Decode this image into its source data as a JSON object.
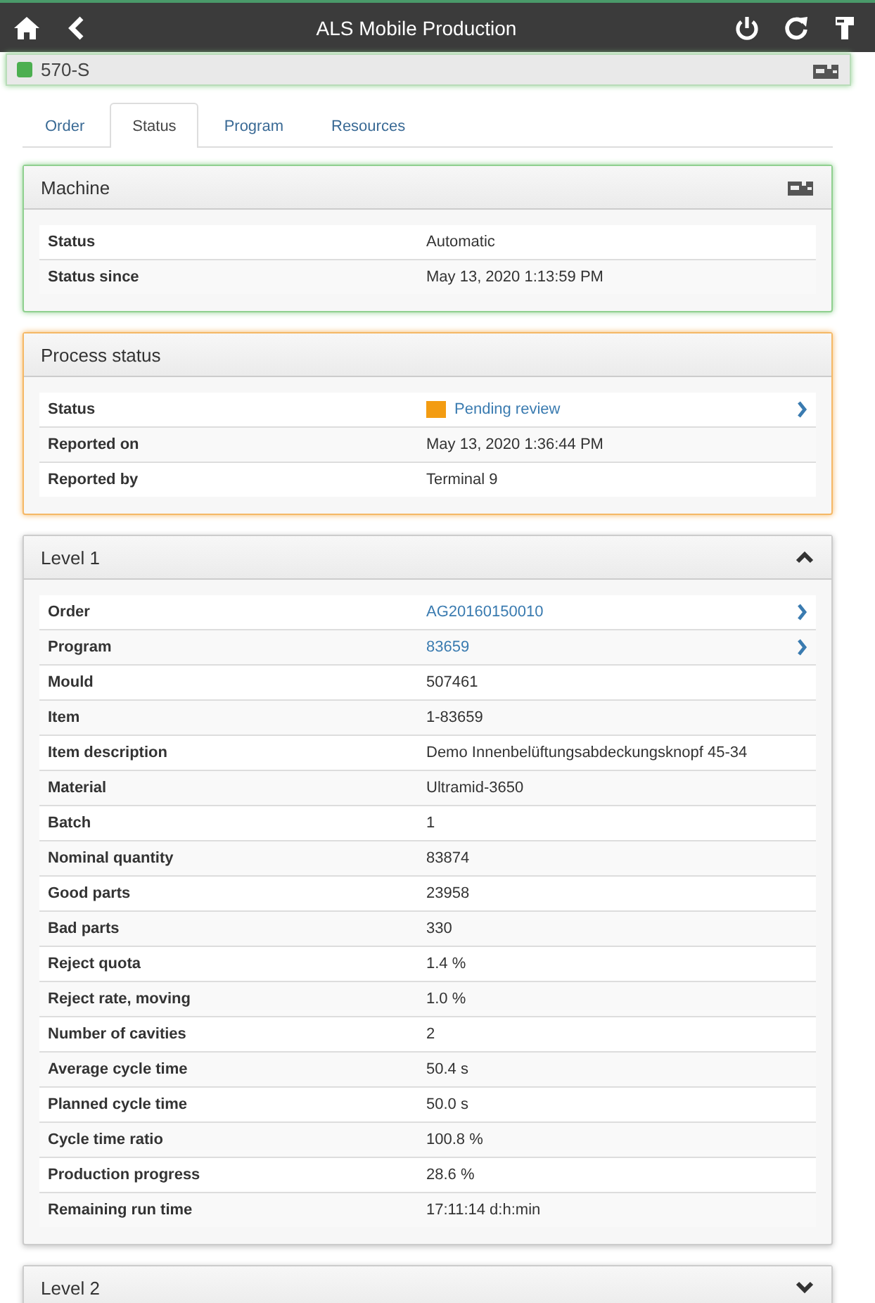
{
  "app_bar": {
    "title": "ALS Mobile Production"
  },
  "machine_bar": {
    "name": "570-S",
    "color": "#4caf50"
  },
  "tabs": [
    {
      "label": "Order",
      "selected": false
    },
    {
      "label": "Status",
      "selected": true
    },
    {
      "label": "Program",
      "selected": false
    },
    {
      "label": "Resources",
      "selected": false
    }
  ],
  "panels": [
    {
      "kind": "machine",
      "title": "Machine",
      "color": "#8fd08f",
      "rows": [
        {
          "label": "Status",
          "value": "Automatic",
          "link": false
        },
        {
          "label": "Status since",
          "value": "May 13, 2020 1:13:59 PM",
          "link": false
        }
      ]
    },
    {
      "kind": "process",
      "title": "Process status",
      "color": "#f5b866",
      "rows": [
        {
          "label": "Status",
          "value": "Pending review",
          "link": true,
          "color": "#f39c12"
        },
        {
          "label": "Reported on",
          "value": "May 13, 2020 1:36:44 PM",
          "link": false
        },
        {
          "label": "Reported by",
          "value": "Terminal 9",
          "link": false
        }
      ]
    },
    {
      "kind": "level",
      "title": "Level 1",
      "expanded": true,
      "rows": [
        {
          "label": "Order",
          "value": "AG20160150010",
          "link": true
        },
        {
          "label": "Program",
          "value": "83659",
          "link": true
        },
        {
          "label": "Mould",
          "value": "507461",
          "link": false
        },
        {
          "label": "Item",
          "value": "1-83659",
          "link": false
        },
        {
          "label": "Item description",
          "value": "Demo Innenbelüftungsabdeckungsknopf 45-34",
          "link": false
        },
        {
          "label": "Material",
          "value": "Ultramid-3650",
          "link": false
        },
        {
          "label": "Batch",
          "value": "1",
          "link": false
        },
        {
          "label": "Nominal quantity",
          "value": "83874",
          "link": false
        },
        {
          "label": "Good parts",
          "value": "23958",
          "link": false
        },
        {
          "label": "Bad parts",
          "value": "330",
          "link": false
        },
        {
          "label": "Reject quota",
          "value": "1.4 %",
          "link": false
        },
        {
          "label": "Reject rate, moving",
          "value": "1.0 %",
          "link": false
        },
        {
          "label": "Number of cavities",
          "value": "2",
          "link": false
        },
        {
          "label": "Average cycle time",
          "value": "50.4 s",
          "link": false
        },
        {
          "label": "Planned cycle time",
          "value": "50.0 s",
          "link": false
        },
        {
          "label": "Cycle time ratio",
          "value": "100.8 %",
          "link": false
        },
        {
          "label": "Production progress",
          "value": "28.6 %",
          "link": false
        },
        {
          "label": "Remaining run time",
          "value": "17:11:14 d:h:min",
          "link": false
        }
      ]
    },
    {
      "kind": "level",
      "title": "Level 2",
      "expanded": false
    }
  ]
}
